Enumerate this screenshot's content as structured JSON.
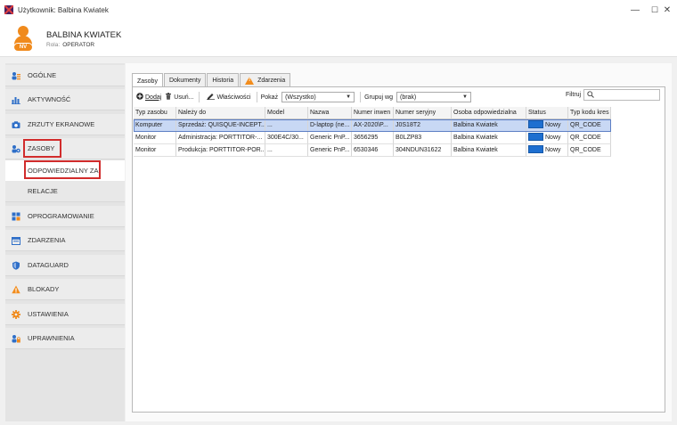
{
  "window": {
    "title": "Użytkownik: Balbina Kwiatek",
    "controls": {
      "minimize": "—",
      "maximize": "☐",
      "close": "✕"
    }
  },
  "user": {
    "name": "BALBINA KWIATEK",
    "role_label": "Rola:",
    "role_value": "OPERATOR",
    "avatar_badge": "NV",
    "avatar_color": "#f08a1c"
  },
  "sidebar": {
    "items": [
      {
        "label": "OGÓLNE",
        "icon": "user-list-icon"
      },
      {
        "label": "AKTYWNOŚĆ",
        "icon": "activity-chart-icon"
      },
      {
        "label": "ZRZUTY EKRANOWE",
        "icon": "camera-icon"
      },
      {
        "label": "ZASOBY",
        "icon": "resources-icon"
      },
      {
        "label": "ODPOWIEDZIALNY ZA",
        "icon": ""
      },
      {
        "label": "RELACJE",
        "icon": ""
      },
      {
        "label": "OPROGRAMOWANIE",
        "icon": "software-icon"
      },
      {
        "label": "ZDARZENIA",
        "icon": "calendar-icon"
      },
      {
        "label": "DATAGUARD",
        "icon": "shield-icon"
      },
      {
        "label": "BLOKADY",
        "icon": "warning-icon"
      },
      {
        "label": "USTAWIENIA",
        "icon": "gear-icon"
      },
      {
        "label": "UPRAWNIENIA",
        "icon": "user-lock-icon"
      }
    ]
  },
  "tabs": [
    {
      "label": "Zasoby"
    },
    {
      "label": "Dokumenty"
    },
    {
      "label": "Historia"
    },
    {
      "label": "Zdarzenia"
    }
  ],
  "toolbar": {
    "add_label": "Dodaj",
    "remove_label": "Usuń...",
    "properties_label": "Właściwości",
    "show_label": "Pokaż",
    "show_value": "(Wszystko)",
    "group_label": "Grupuj wg",
    "group_value": "(brak)",
    "filter_label": "Filtruj"
  },
  "table": {
    "columns": [
      "Typ zasobu",
      "Należy do",
      "Model",
      "Nazwa",
      "Numer inwen",
      "Numer seryjny",
      "Osoba odpowiedzialna",
      "Status",
      "Typ kodu kres"
    ],
    "rows": [
      [
        "Komputer",
        "Sprzedaż: QUISQUE-INCEPT...",
        "...",
        "D-laptop (ne...",
        "AX-2020\\P...",
        "J0S18T2",
        "Balbina Kwiatek",
        "Nowy",
        "QR_CODE"
      ],
      [
        "Monitor",
        "Administracja: PORTTITOR-...",
        "300E4C/30...",
        "Generic PnP...",
        "3656295",
        "B0LZP83",
        "Balbina Kwiatek",
        "Nowy",
        "QR_CODE"
      ],
      [
        "Monitor",
        "Produkcja: PORTTITOR-POR...",
        "...",
        "Generic PnP...",
        "6530346",
        "304NDUN31622",
        "Balbina Kwiatek",
        "Nowy",
        "QR_CODE"
      ]
    ],
    "status_color": "#1e6fd0",
    "selected_row": 0
  }
}
